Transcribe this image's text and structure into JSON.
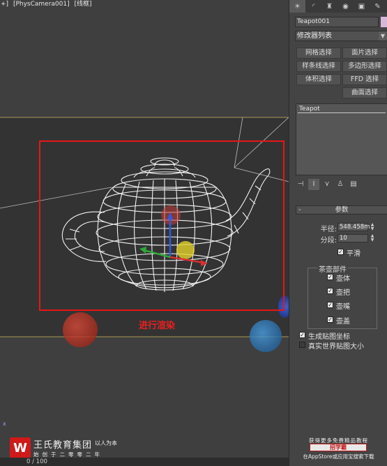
{
  "viewport": {
    "label_parts": [
      "+]",
      "[PhysCamera001]",
      "[线框]"
    ],
    "render_caption": "进行渲染",
    "timeline": "0 / 100",
    "axis_label": "x"
  },
  "watermark": {
    "logo_letter": "W",
    "brand_name": "王氏教育集团",
    "slogan": "以人为本",
    "sub": "始创于二零零二年"
  },
  "panel": {
    "tabs": [
      "sun-icon",
      "arc-icon",
      "hierarchy-icon",
      "motion-icon",
      "display-icon",
      "utilities-icon"
    ],
    "object_name": "Teapot001",
    "color_swatch": "#d8b8d8",
    "modifier_list": "修改器列表",
    "buttons": {
      "mesh_select": "网格选择",
      "patch_select": "面片选择",
      "spline_select": "样条线选择",
      "poly_select": "多边形选择",
      "volume_select": "体积选择",
      "ffd_select": "FFD 选择",
      "surface_select": "曲面选择"
    },
    "stack_item": "Teapot",
    "rollout_title": "参数",
    "radius_label": "半径:",
    "radius_value": "548.458m",
    "segments_label": "分段:",
    "segments_value": "10",
    "smooth_label": "平滑",
    "parts_title": "茶壶部件",
    "parts": [
      "壶体",
      "壶把",
      "壶嘴",
      "壶盖"
    ],
    "gen_map_coords": "生成贴图坐标",
    "real_world_map": "真实世界贴图大小",
    "promo_top": "获得更多免费精品教程",
    "promo_mid": "招学霸",
    "promo_bottom": "在AppStore或应用宝搜索下载"
  }
}
